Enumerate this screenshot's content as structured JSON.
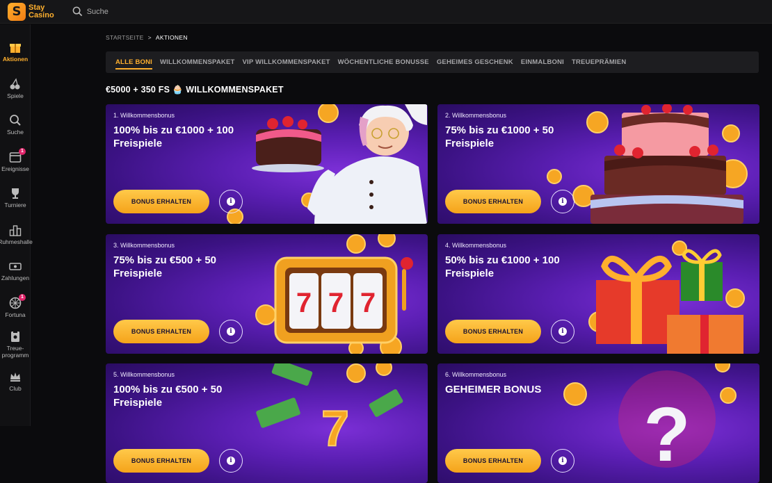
{
  "brand": {
    "logo_mark": "S",
    "name_line1": "Stay",
    "name_line2": "Casino"
  },
  "search": {
    "label": "Suche"
  },
  "sidebar": {
    "items": [
      {
        "label": "Aktionen",
        "icon": "gift-icon",
        "active": true
      },
      {
        "label": "Spiele",
        "icon": "cherries-icon"
      },
      {
        "label": "Suche",
        "icon": "search-icon"
      },
      {
        "label": "Ereignisse",
        "icon": "calendar-icon",
        "badge": "1"
      },
      {
        "label": "Turniere",
        "icon": "trophy-icon"
      },
      {
        "label": "Ruhmeshalle",
        "icon": "podium-icon"
      },
      {
        "label": "Zahlungen",
        "icon": "payment-icon"
      },
      {
        "label": "Fortuna",
        "icon": "wheel-icon",
        "badge": "1"
      },
      {
        "label": "Treue-",
        "label2": "programm",
        "icon": "loyalty-icon"
      },
      {
        "label": "Club",
        "icon": "crown-icon"
      }
    ]
  },
  "breadcrumb": {
    "home": "STARTSEITE",
    "separator": ">",
    "current": "AKTIONEN"
  },
  "tabs": [
    {
      "label": "ALLE BONI",
      "active": true
    },
    {
      "label": "WILLKOMMENSPAKET"
    },
    {
      "label": "VIP WILLKOMMENSPAKET"
    },
    {
      "label": "WÖCHENTLICHE BONUSSE"
    },
    {
      "label": "GEHEIMES GESCHENK"
    },
    {
      "label": "EINMALBONI"
    },
    {
      "label": "TREUEPRÄMIEN"
    }
  ],
  "section_title": "€5000 + 350 FS 🧁 WILLKOMMENSPAKET",
  "cards": [
    {
      "number": "1. Willkommensbonus",
      "title": "100% bis zu €1000 + 100 Freispiele",
      "button": "BONUS ERHALTEN",
      "art": "chef-cake"
    },
    {
      "number": "2. Willkommensbonus",
      "title": "75% bis zu €1000 + 50 Freispiele",
      "button": "BONUS ERHALTEN",
      "art": "tiered-cake"
    },
    {
      "number": "3. Willkommensbonus",
      "title": "75% bis zu €500 + 50 Freispiele",
      "button": "BONUS ERHALTEN",
      "art": "slot-machine"
    },
    {
      "number": "4. Willkommensbonus",
      "title": "50% bis zu €1000 + 100 Freispiele",
      "button": "BONUS ERHALTEN",
      "art": "gift-boxes"
    },
    {
      "number": "5. Willkommensbonus",
      "title": "100% bis zu €500 + 50 Freispiele",
      "button": "BONUS ERHALTEN",
      "art": "money-sevens"
    },
    {
      "number": "6. Willkommensbonus",
      "title": "GEHEIMER BONUS",
      "button": "BONUS ERHALTEN",
      "art": "question-mark"
    }
  ],
  "slot_symbol": "7",
  "mystery_symbol": "?",
  "info_glyph": "i",
  "colors": {
    "accent": "#ffb02e",
    "card_purple": "#5a1eb2",
    "badge": "#e0246a"
  }
}
